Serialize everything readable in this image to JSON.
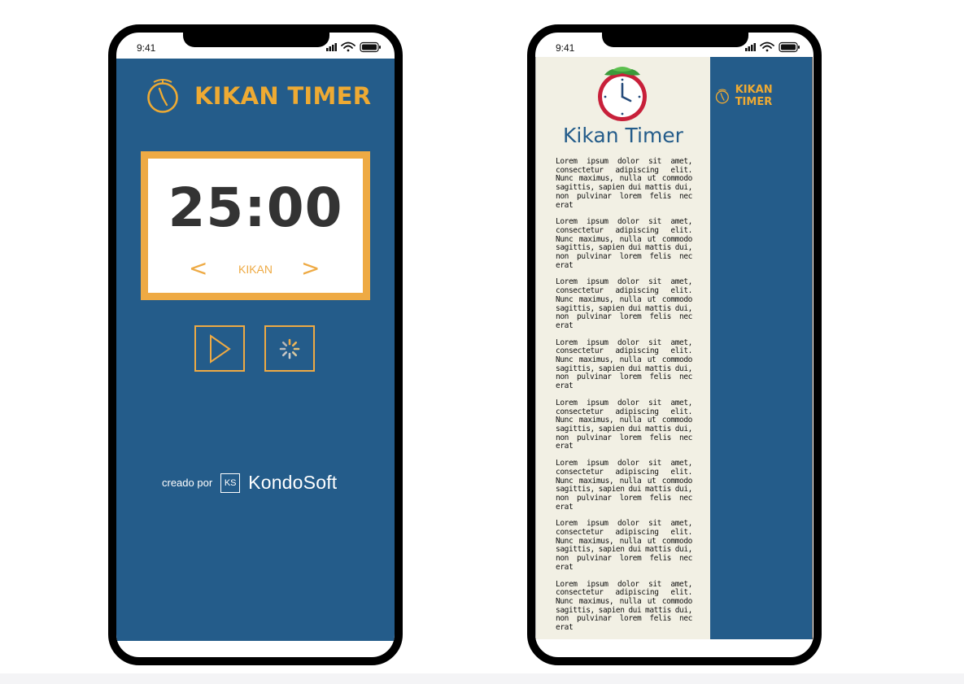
{
  "status_bar": {
    "time": "9:41"
  },
  "timer_screen": {
    "brand_title": "KIKAN TIMER",
    "timer_value": "25:00",
    "mode": {
      "prev": "<",
      "label": "KIKAN",
      "next": ">"
    },
    "controls": [
      "play",
      "reset"
    ],
    "credits": {
      "prefix": "creado por",
      "logo_mark": "KS",
      "company": "KondoSoft"
    }
  },
  "info_screen": {
    "title": "Kikan Timer",
    "side_brand_title": "KIKAN TIMER",
    "paragraphs": [
      "Lorem ipsum dolor sit amet, consectetur adipiscing elit. Nunc maximus, nulla ut commodo sagittis, sapien dui mattis dui, non pulvinar lorem felis nec erat",
      "Lorem ipsum dolor sit amet, consectetur adipiscing elit. Nunc maximus, nulla ut commodo sagittis, sapien dui mattis dui, non pulvinar lorem felis nec erat",
      "Lorem ipsum dolor sit amet, consectetur adipiscing elit. Nunc maximus, nulla ut commodo sagittis, sapien dui mattis dui, non pulvinar lorem felis nec erat",
      "Lorem ipsum dolor sit amet, consectetur adipiscing elit. Nunc maximus, nulla ut commodo sagittis, sapien dui mattis dui, non pulvinar lorem felis nec erat",
      "Lorem ipsum dolor sit amet, consectetur adipiscing elit. Nunc maximus, nulla ut commodo sagittis, sapien dui mattis dui, non pulvinar lorem felis nec erat",
      "Lorem ipsum dolor sit amet, consectetur adipiscing elit. Nunc maximus, nulla ut commodo sagittis, sapien dui mattis dui, non pulvinar lorem felis nec erat",
      "Lorem ipsum dolor sit amet, consectetur adipiscing elit. Nunc maximus, nulla ut commodo sagittis, sapien dui mattis dui, non pulvinar lorem felis nec erat",
      "Lorem ipsum dolor sit amet, consectetur adipiscing elit. Nunc maximus, nulla ut commodo sagittis, sapien dui mattis dui, non pulvinar lorem felis nec erat"
    ]
  },
  "colors": {
    "primary": "#245c8a",
    "accent": "#eeaa44",
    "panel_bg": "#f2f0e4",
    "digits": "#333333"
  },
  "icons": [
    "stopwatch-icon",
    "play-icon",
    "spinner-icon",
    "clock-logo-icon",
    "signal-icon",
    "wifi-icon",
    "battery-icon"
  ]
}
